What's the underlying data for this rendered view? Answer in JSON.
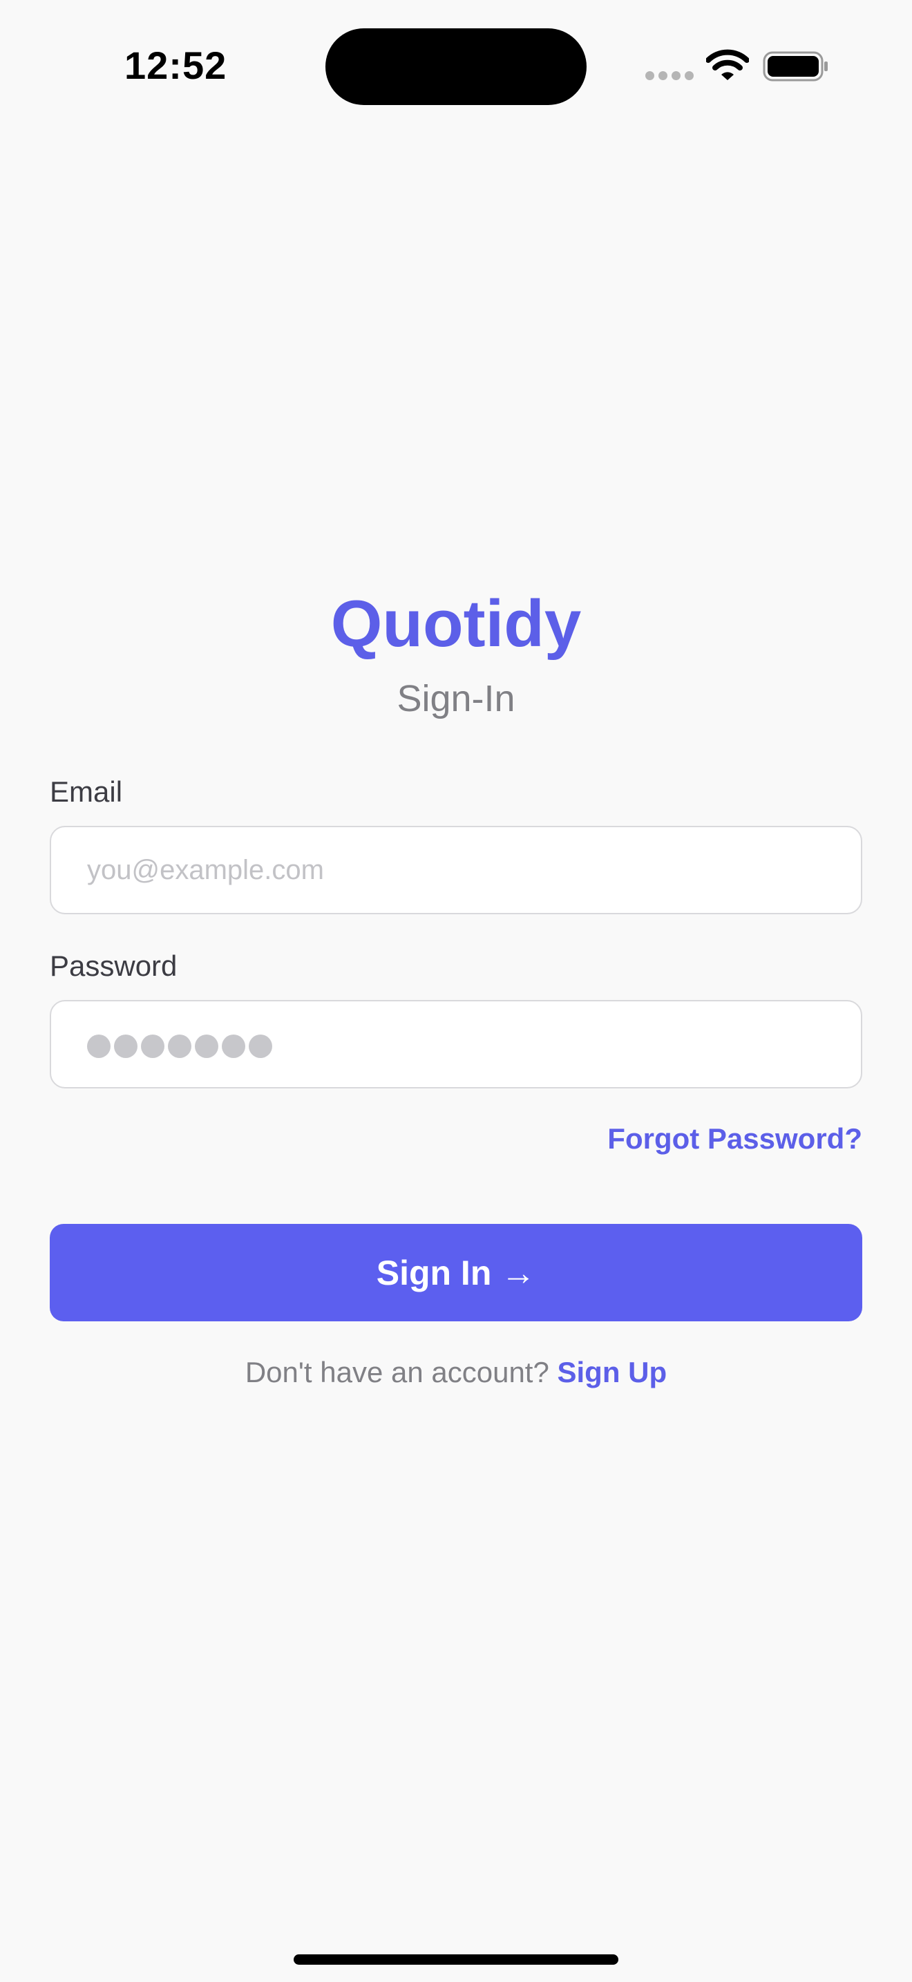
{
  "status_bar": {
    "time": "12:52",
    "icons": [
      "signal-icon",
      "wifi-icon",
      "battery-icon"
    ]
  },
  "app": {
    "title": "Quotidy",
    "subtitle": "Sign-In"
  },
  "form": {
    "email": {
      "label": "Email",
      "placeholder": "you@example.com",
      "value": ""
    },
    "password": {
      "label": "Password",
      "masked_length": 7
    },
    "forgot_password": "Forgot Password?",
    "submit_label": "Sign In →",
    "signup_prompt": "Don't have an account?",
    "signup_link": "Sign Up"
  },
  "colors": {
    "accent": "#5c5fe8",
    "button": "#5c5fef",
    "background": "#f9f9f9",
    "muted_text": "#808085"
  }
}
